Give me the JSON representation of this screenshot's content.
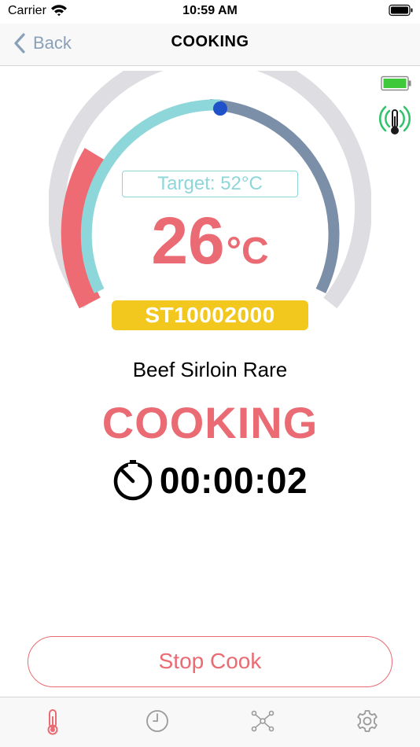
{
  "status_bar": {
    "carrier": "Carrier",
    "time": "10:59 AM",
    "icons": [
      "wifi-icon",
      "battery-icon"
    ]
  },
  "nav": {
    "back_label": "Back",
    "title": "COOKING"
  },
  "indicators": {
    "device_battery_icon": "battery-full-icon",
    "device_battery_color": "#3ec93a",
    "probe_signal_icon": "probe-signal-icon",
    "probe_signal_color": "#2fc46a"
  },
  "gauge": {
    "target_label": "Target: 52°C",
    "current_temp": "26",
    "unit": "°C",
    "progress_fraction": 0.5,
    "colors": {
      "track": "#dedee2",
      "hot_zone": "#ee6b73",
      "progress": "#8dd6d9",
      "remaining": "#7c8fa8",
      "knob": "#1f52c8",
      "accent": "#ea6b73"
    }
  },
  "probe_id": "ST10002000",
  "recipe_name": "Beef Sirloin Rare",
  "cook_status": "COOKING",
  "timer": {
    "icon": "stopwatch-icon",
    "value": "00:00:02"
  },
  "stop_button_label": "Stop Cook",
  "tabs": [
    {
      "icon": "thermometer-icon",
      "active": true
    },
    {
      "icon": "clock-icon",
      "active": false
    },
    {
      "icon": "network-icon",
      "active": false
    },
    {
      "icon": "gear-icon",
      "active": false
    }
  ]
}
